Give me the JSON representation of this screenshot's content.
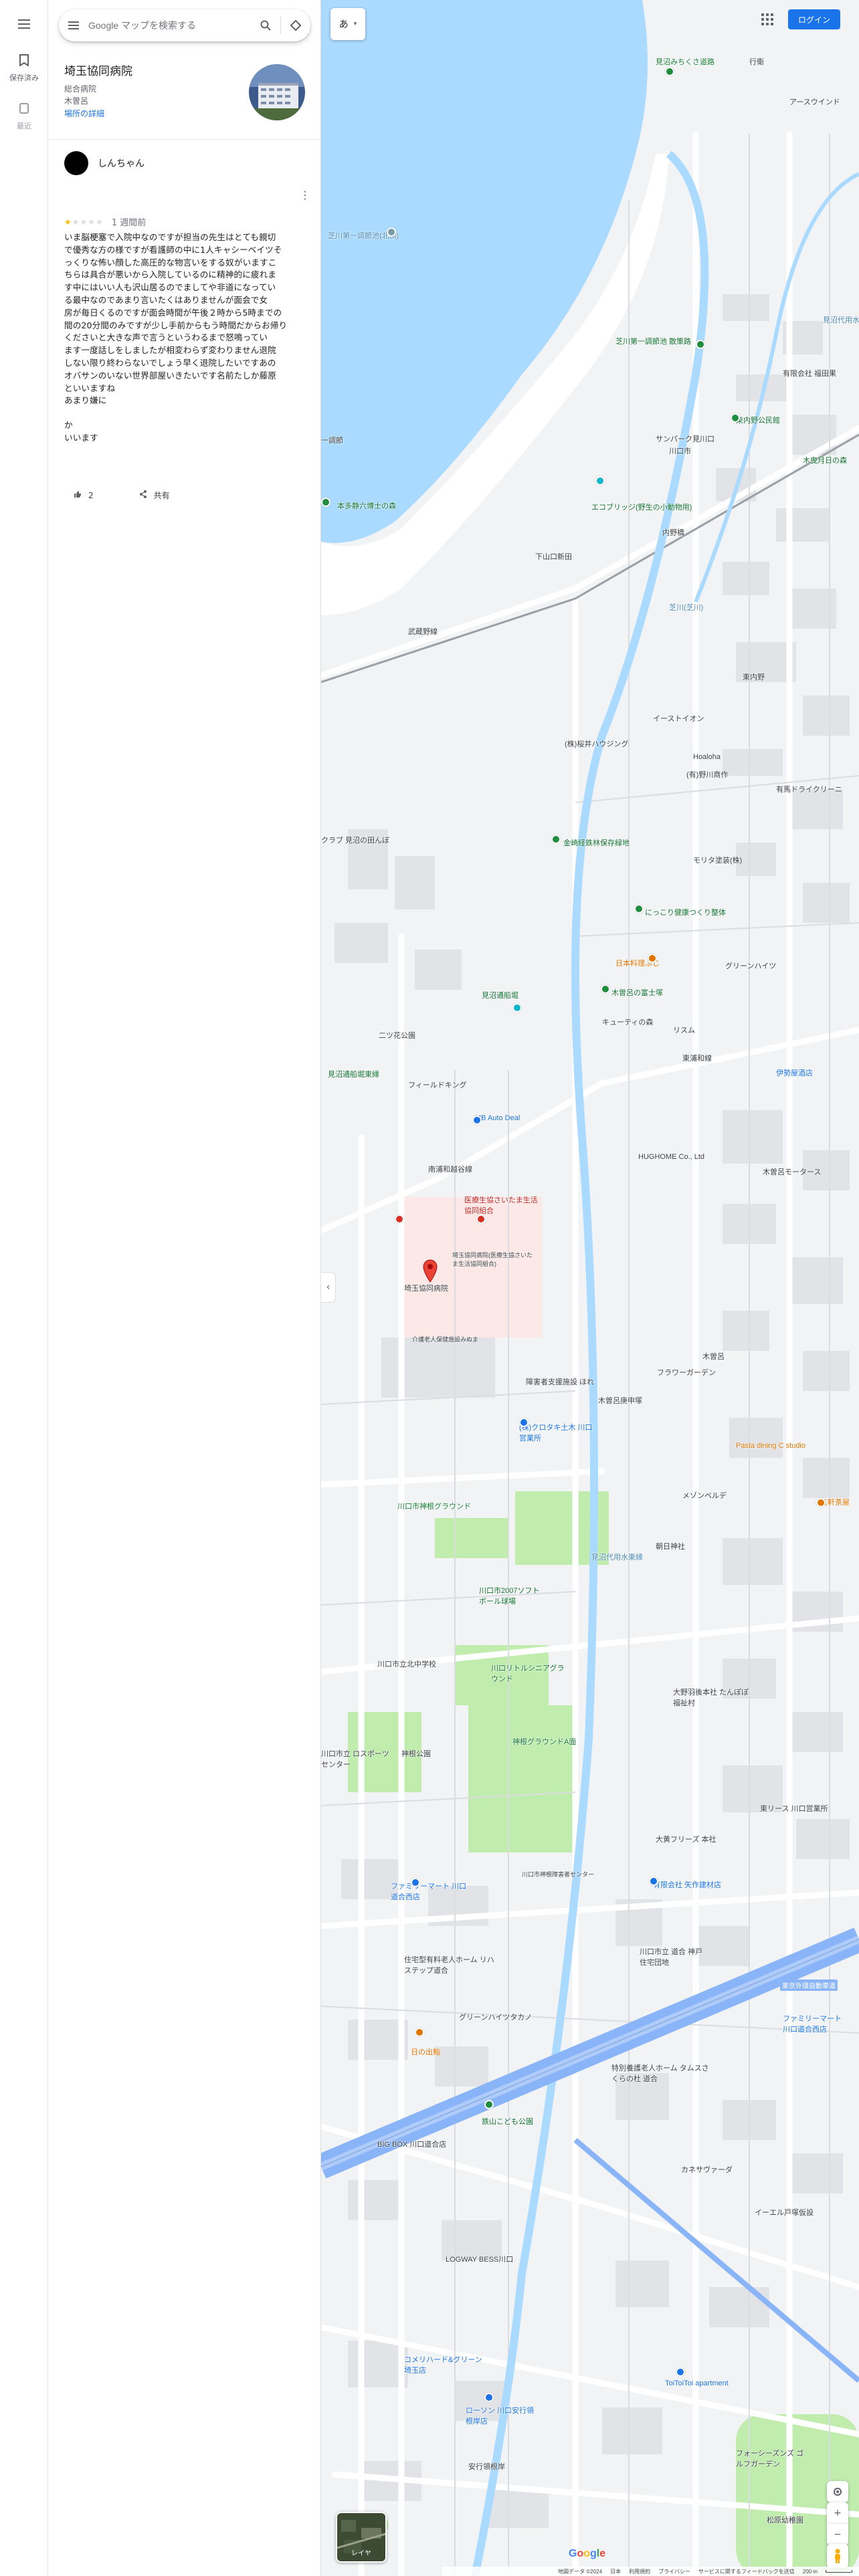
{
  "rail": {
    "saved_label": "保存済み",
    "recent_label": "最近"
  },
  "search": {
    "placeholder": "Google マップを検索する"
  },
  "place": {
    "name": "埼玉協同病院",
    "category": "総合病院",
    "area": "木曽呂",
    "details_link": "場所の詳細"
  },
  "review": {
    "user_name": "しんちゃん",
    "rating": 1,
    "max_rating": 5,
    "time_ago": "1 週間前",
    "body_lines": [
      "いま脳梗塞で入院中なのですが担当の先生はとても親切",
      "で優秀な方の様ですが看護師の中に1人キャシーベイツそ",
      "っくりな怖い顔した高圧的な物言いをする奴がいますこ",
      "ちらは具合が悪いから入院しているのに精神的に疲れま",
      "す中にはいい人も沢山居るのでましてや非道になってい",
      "る最中なのであまり言いたくはありませんが面会で女",
      "房が毎日くるのですが面会時間が午後２時から5時までの",
      "間の20分間のみですが少し手前からもう時間だからお帰り",
      "くださいと大きな声で言うというわるまで怒鳴ってい",
      "ます一度話しをしましたが相変わらず変わりません退院",
      "しない限り終わらないでしょう早く退院したいですあの",
      "オバサンのいない世界部屋いきたいです名前たしか藤原",
      "といいますね",
      "あまり嫌に"
    ],
    "tail_lines": [
      "か",
      "いいます"
    ],
    "likes": "2",
    "share_label": "共有"
  },
  "map": {
    "ime_label": "あ",
    "login_label": "ログイン",
    "layers_label": "レイヤ",
    "labels": [
      {
        "text": "見沼みちくさ道路",
        "cls": "green"
      },
      {
        "text": "行衛",
        "cls": ""
      },
      {
        "text": "アースウインド",
        "cls": ""
      },
      {
        "text": "芝川第一調節池(北側)",
        "cls": "water"
      },
      {
        "text": "芝川第一調節池 散策路",
        "cls": "teal"
      },
      {
        "text": "見沼代用水",
        "cls": "water"
      },
      {
        "text": "有限会社 福田果",
        "cls": ""
      },
      {
        "text": "東内野公民館",
        "cls": "teal"
      },
      {
        "text": "サンパーク見川口",
        "cls": ""
      },
      {
        "text": "川口市",
        "cls": ""
      },
      {
        "text": "木曳月日の森",
        "cls": "teal"
      },
      {
        "text": "一調節",
        "cls": ""
      },
      {
        "text": "本多静六博士の森",
        "cls": "teal"
      },
      {
        "text": "エコブリッジ(野生の小動物用)",
        "cls": "teal"
      },
      {
        "text": "内野橋",
        "cls": ""
      },
      {
        "text": "下山口新田",
        "cls": ""
      },
      {
        "text": "武蔵野線",
        "cls": ""
      },
      {
        "text": "芝川(芝川)",
        "cls": "water"
      },
      {
        "text": "東内野",
        "cls": ""
      },
      {
        "text": "イーストイオン",
        "cls": ""
      },
      {
        "text": "Hoaloha",
        "cls": ""
      },
      {
        "text": "(株)桜井ハウジング",
        "cls": ""
      },
      {
        "text": "(有)野川商作",
        "cls": ""
      },
      {
        "text": "有馬ドライクリーニ",
        "cls": ""
      },
      {
        "text": "クラブ 見沼の田んぼ",
        "cls": ""
      },
      {
        "text": "金崎経鉄林保存緑地",
        "cls": "teal"
      },
      {
        "text": "モリタ塗装(株)",
        "cls": ""
      },
      {
        "text": "にっこり健康つくり整体",
        "cls": "teal"
      },
      {
        "text": "日本料理ふじ",
        "cls": "orange"
      },
      {
        "text": "木曽呂の富士塚",
        "cls": "teal"
      },
      {
        "text": "グリーンハイツ",
        "cls": ""
      },
      {
        "text": "見沼通船堀",
        "cls": "teal"
      },
      {
        "text": "見沼通船堀東縁",
        "cls": "teal"
      },
      {
        "text": "二ツ花公園",
        "cls": ""
      },
      {
        "text": "キューティの森",
        "cls": ""
      },
      {
        "text": "リスム",
        "cls": ""
      },
      {
        "text": "東浦和線",
        "cls": ""
      },
      {
        "text": "伊勢屋酒店",
        "cls": "blue"
      },
      {
        "text": "フィールドキング",
        "cls": ""
      },
      {
        "text": "MB Auto Deal",
        "cls": "blue"
      },
      {
        "text": "HUGHOME Co., Ltd",
        "cls": ""
      },
      {
        "text": "木曽呂モータース",
        "cls": ""
      },
      {
        "text": "南浦和越谷線",
        "cls": ""
      },
      {
        "text": "医療生協さいたま生活協同組合",
        "cls": "red"
      },
      {
        "text": "埼玉協同病院(医療生協さいたま生活協同組合)",
        "cls": ""
      },
      {
        "text": "埼玉協同病院",
        "cls": ""
      },
      {
        "text": "介護老人保健施設みぬま",
        "cls": ""
      },
      {
        "text": "障害者支援施設 ほれ",
        "cls": ""
      },
      {
        "text": "木曽呂庚申塚",
        "cls": ""
      },
      {
        "text": "フラワーガーデン",
        "cls": ""
      },
      {
        "text": "(株)クロタキ土木 川口営業所",
        "cls": "blue"
      },
      {
        "text": "木曽呂",
        "cls": ""
      },
      {
        "text": "見沼代用水東縁",
        "cls": "water"
      },
      {
        "text": "Pasta dining C studio",
        "cls": "orange"
      },
      {
        "text": "メゾンベルデ",
        "cls": ""
      },
      {
        "text": "五軒茶屋",
        "cls": "orange"
      },
      {
        "text": "川口市神根グラウンド",
        "cls": "green"
      },
      {
        "text": "朝日神社",
        "cls": ""
      },
      {
        "text": "川口市2007ソフトボール球場",
        "cls": "teal"
      },
      {
        "text": "川口市立北中学校",
        "cls": ""
      },
      {
        "text": "川口リトルシニアグラウンド",
        "cls": "teal"
      },
      {
        "text": "大野羽後本社 たんぽぽ福祉村",
        "cls": ""
      },
      {
        "text": "神根グラウンドA面",
        "cls": "teal"
      },
      {
        "text": "神根公園",
        "cls": ""
      },
      {
        "text": "川口市立 ロスポーツセンター",
        "cls": ""
      },
      {
        "text": "大黄フリーズ 本社",
        "cls": ""
      },
      {
        "text": "東リース 川口営業所",
        "cls": ""
      },
      {
        "text": "ファミリーマート 川口道合西店",
        "cls": "blue"
      },
      {
        "text": "川口市神根障害者センター",
        "cls": ""
      },
      {
        "text": "有限会社 矢作建材店",
        "cls": "blue"
      },
      {
        "text": "住宅型有料老人ホーム リハステップ道合",
        "cls": ""
      },
      {
        "text": "川口市立 道合 神戸住宅団地",
        "cls": ""
      },
      {
        "text": "グリーンハイツタカノ",
        "cls": ""
      },
      {
        "text": "日の出鮨",
        "cls": "orange"
      },
      {
        "text": "特別養護老人ホーム タムスさくらの杜 道合",
        "cls": ""
      },
      {
        "text": "ファミリーマート 川口道合西店",
        "cls": "blue"
      },
      {
        "text": "東京外環自動車道",
        "cls": ""
      },
      {
        "text": "鉄山こども公園",
        "cls": "teal"
      },
      {
        "text": "BIG BOX 川口道合店",
        "cls": ""
      },
      {
        "text": "カネサヴァーダ",
        "cls": ""
      },
      {
        "text": "イーエル戸塚仮設",
        "cls": ""
      },
      {
        "text": "LOGWAY BESS川口",
        "cls": ""
      },
      {
        "text": "コメリハード&グリーン 埼玉店",
        "cls": "blue"
      },
      {
        "text": "ToiToiToi apartment",
        "cls": "blue"
      },
      {
        "text": "ローソン 川口安行領根岸店",
        "cls": "blue"
      },
      {
        "text": "フォーシーズンズ ゴルフガーデン",
        "cls": ""
      },
      {
        "text": "松原幼稚園",
        "cls": ""
      },
      {
        "text": "安行領根岸",
        "cls": ""
      }
    ],
    "footer": {
      "data": "地図データ ©2024",
      "japan": "日本",
      "terms": "利用規約",
      "privacy": "プライバシー",
      "feedback": "サービスに関するフィードバックを送信",
      "scale": "200 m"
    }
  },
  "colors": {
    "water": "#aadaff",
    "park": "#c0ecae",
    "road": "#ffffff",
    "highway": "#8ab4f8",
    "accent": "#1a73e8",
    "star": "#fbbc04"
  }
}
